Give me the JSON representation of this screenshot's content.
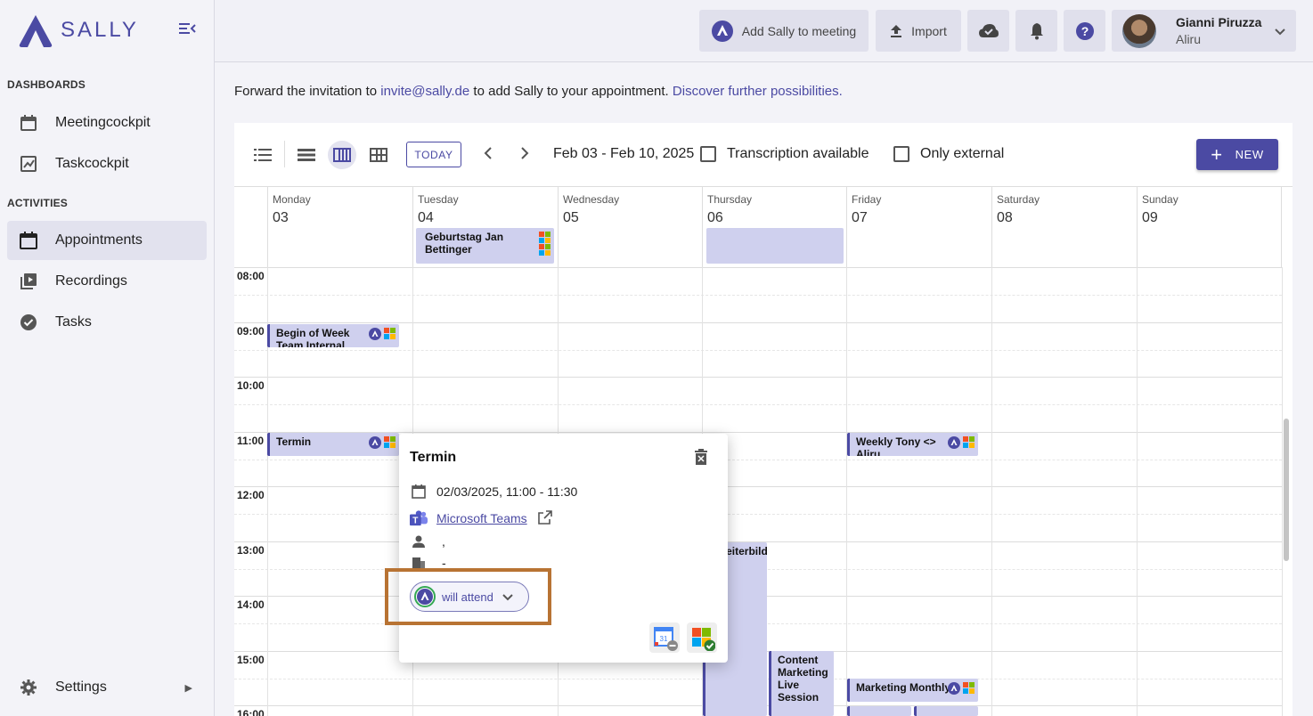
{
  "brand": {
    "name": "SALLY",
    "color": "#4b4aa3"
  },
  "sidebar": {
    "sections": {
      "dashboards": "DASHBOARDS",
      "activities": "ACTIVITIES"
    },
    "items": [
      {
        "label": "Meetingcockpit",
        "icon": "calendar-icon"
      },
      {
        "label": "Taskcockpit",
        "icon": "chart-icon"
      },
      {
        "label": "Appointments",
        "icon": "calendar-icon",
        "active": true
      },
      {
        "label": "Recordings",
        "icon": "video-library-icon"
      },
      {
        "label": "Tasks",
        "icon": "check-circle-icon"
      }
    ],
    "settings_label": "Settings"
  },
  "header": {
    "add_sally": "Add Sally to meeting",
    "import": "Import",
    "user_name": "Gianni Piruzza",
    "user_org": "Aliru"
  },
  "info": {
    "prefix": "Forward the invitation to",
    "email": "invite@sally.de",
    "middle": "to add Sally to your appointment.",
    "link": "Discover further possibilities."
  },
  "toolbar": {
    "today": "TODAY",
    "range": "Feb 03 - Feb 10, 2025",
    "transcription": "Transcription available",
    "only_external": "Only external",
    "new": "NEW"
  },
  "days": [
    {
      "name": "Monday",
      "date": "03"
    },
    {
      "name": "Tuesday",
      "date": "04"
    },
    {
      "name": "Wednesday",
      "date": "05"
    },
    {
      "name": "Thursday",
      "date": "06"
    },
    {
      "name": "Friday",
      "date": "07"
    },
    {
      "name": "Saturday",
      "date": "08"
    },
    {
      "name": "Sunday",
      "date": "09"
    }
  ],
  "times": [
    "08:00",
    "09:00",
    "10:00",
    "11:00",
    "12:00",
    "13:00",
    "14:00",
    "15:00",
    "16:00"
  ],
  "events": {
    "birthday": "Geburtstag Jan Bettinger",
    "begin_week": "Begin of Week Team Internal",
    "termin": "Termin",
    "weekly": "Weekly Tony <> Aliru",
    "weiterbildung": "Weiterbildung",
    "content": "Content Marketing Live Session",
    "marketing": "Marketing Monthly"
  },
  "popup": {
    "title": "Termin",
    "datetime": "02/03/2025, 11:00 - 11:30",
    "link": "Microsoft Teams",
    "person": ",",
    "location": "-",
    "attend": "will attend"
  }
}
